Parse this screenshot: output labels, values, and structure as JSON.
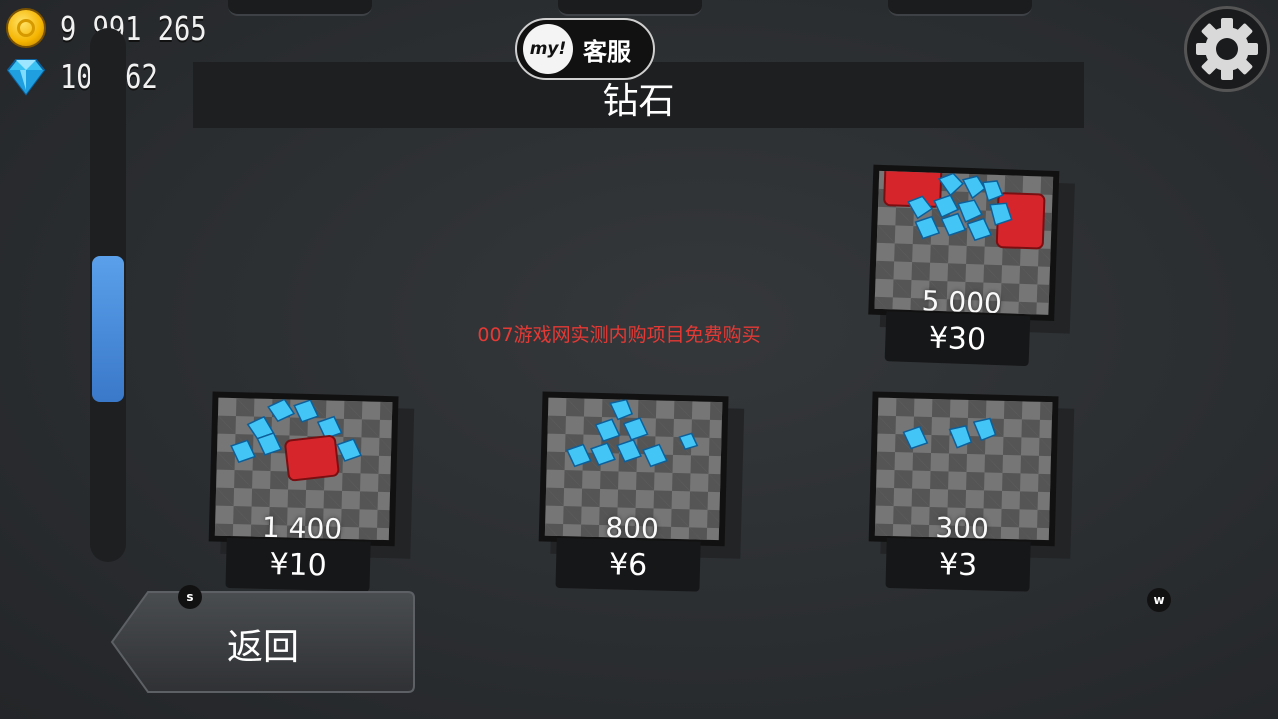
{
  "currency": {
    "coins": "9 991 265",
    "gems": "10 062",
    "coin_icon": "gold-coin-icon",
    "gem_icon": "blue-diamond-icon"
  },
  "header": {
    "title": "钻石"
  },
  "customer_service": {
    "badge": "my!",
    "label": "客服"
  },
  "settings": {
    "icon": "gear-icon"
  },
  "promo_text": "007游戏网实测内购项目免费购买",
  "products": [
    {
      "amount": "5 000",
      "price": "¥30",
      "art": "gem-chests"
    },
    {
      "amount": "1 400",
      "price": "¥10",
      "art": "gem-pile-with-chest"
    },
    {
      "amount": "800",
      "price": "¥6",
      "art": "gem-pile"
    },
    {
      "amount": "300",
      "price": "¥3",
      "art": "few-gems"
    }
  ],
  "back_button": {
    "label": "返回",
    "hotkey": "s"
  },
  "hotkey_w": "w",
  "colors": {
    "accent_blue": "#4a8ee0",
    "promo_red": "#e53935",
    "gem_blue": "#43c6f5",
    "chest_red": "#d6262c"
  }
}
